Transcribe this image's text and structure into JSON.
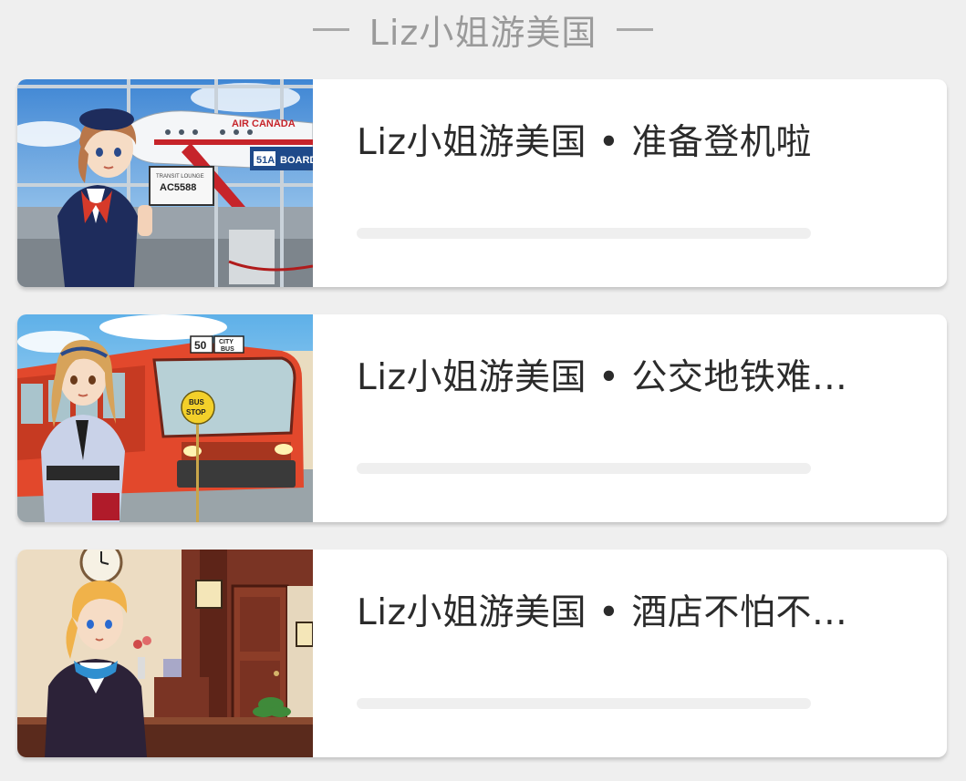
{
  "header": {
    "title": "Liz小姐游美国"
  },
  "lessons": [
    {
      "title": "Liz小姐游美国 • 准备登机啦",
      "thumbnail": "airport-stewardess-illustration",
      "progress": 0,
      "image_text": {
        "sign_header": "TRANSIT LOUNGE",
        "sign_flight": "AC5588",
        "gate": "51A",
        "gate_word": "BOARD",
        "airline": "AIR CANADA"
      }
    },
    {
      "title": "Liz小姐游美国 • 公交地铁难…",
      "thumbnail": "city-bus-illustration",
      "progress": 0,
      "image_text": {
        "bus_number": "50",
        "bus_sign_line1": "CITY",
        "bus_sign_line2": "BUS",
        "stop_line1": "BUS",
        "stop_line2": "STOP"
      }
    },
    {
      "title": "Liz小姐游美国 • 酒店不怕不…",
      "thumbnail": "hotel-reception-illustration",
      "progress": 0,
      "image_text": {}
    }
  ],
  "colors": {
    "background": "#efefef",
    "card": "#ffffff",
    "title_text": "#2b2b2b",
    "header_text": "#9a9a9a",
    "progress_track": "#efefef"
  }
}
